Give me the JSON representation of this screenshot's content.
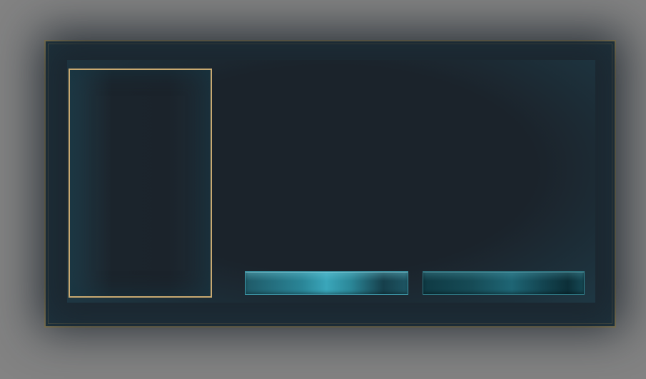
{
  "dialog": {
    "frame_color": "#9a8a5c",
    "background_color": "#1e3743",
    "portrait": {
      "border_color": "#c8a971"
    },
    "buttons": {
      "primary": {
        "label": "",
        "color": "#2a8597"
      },
      "secondary": {
        "label": "",
        "color": "#164b56"
      }
    }
  }
}
